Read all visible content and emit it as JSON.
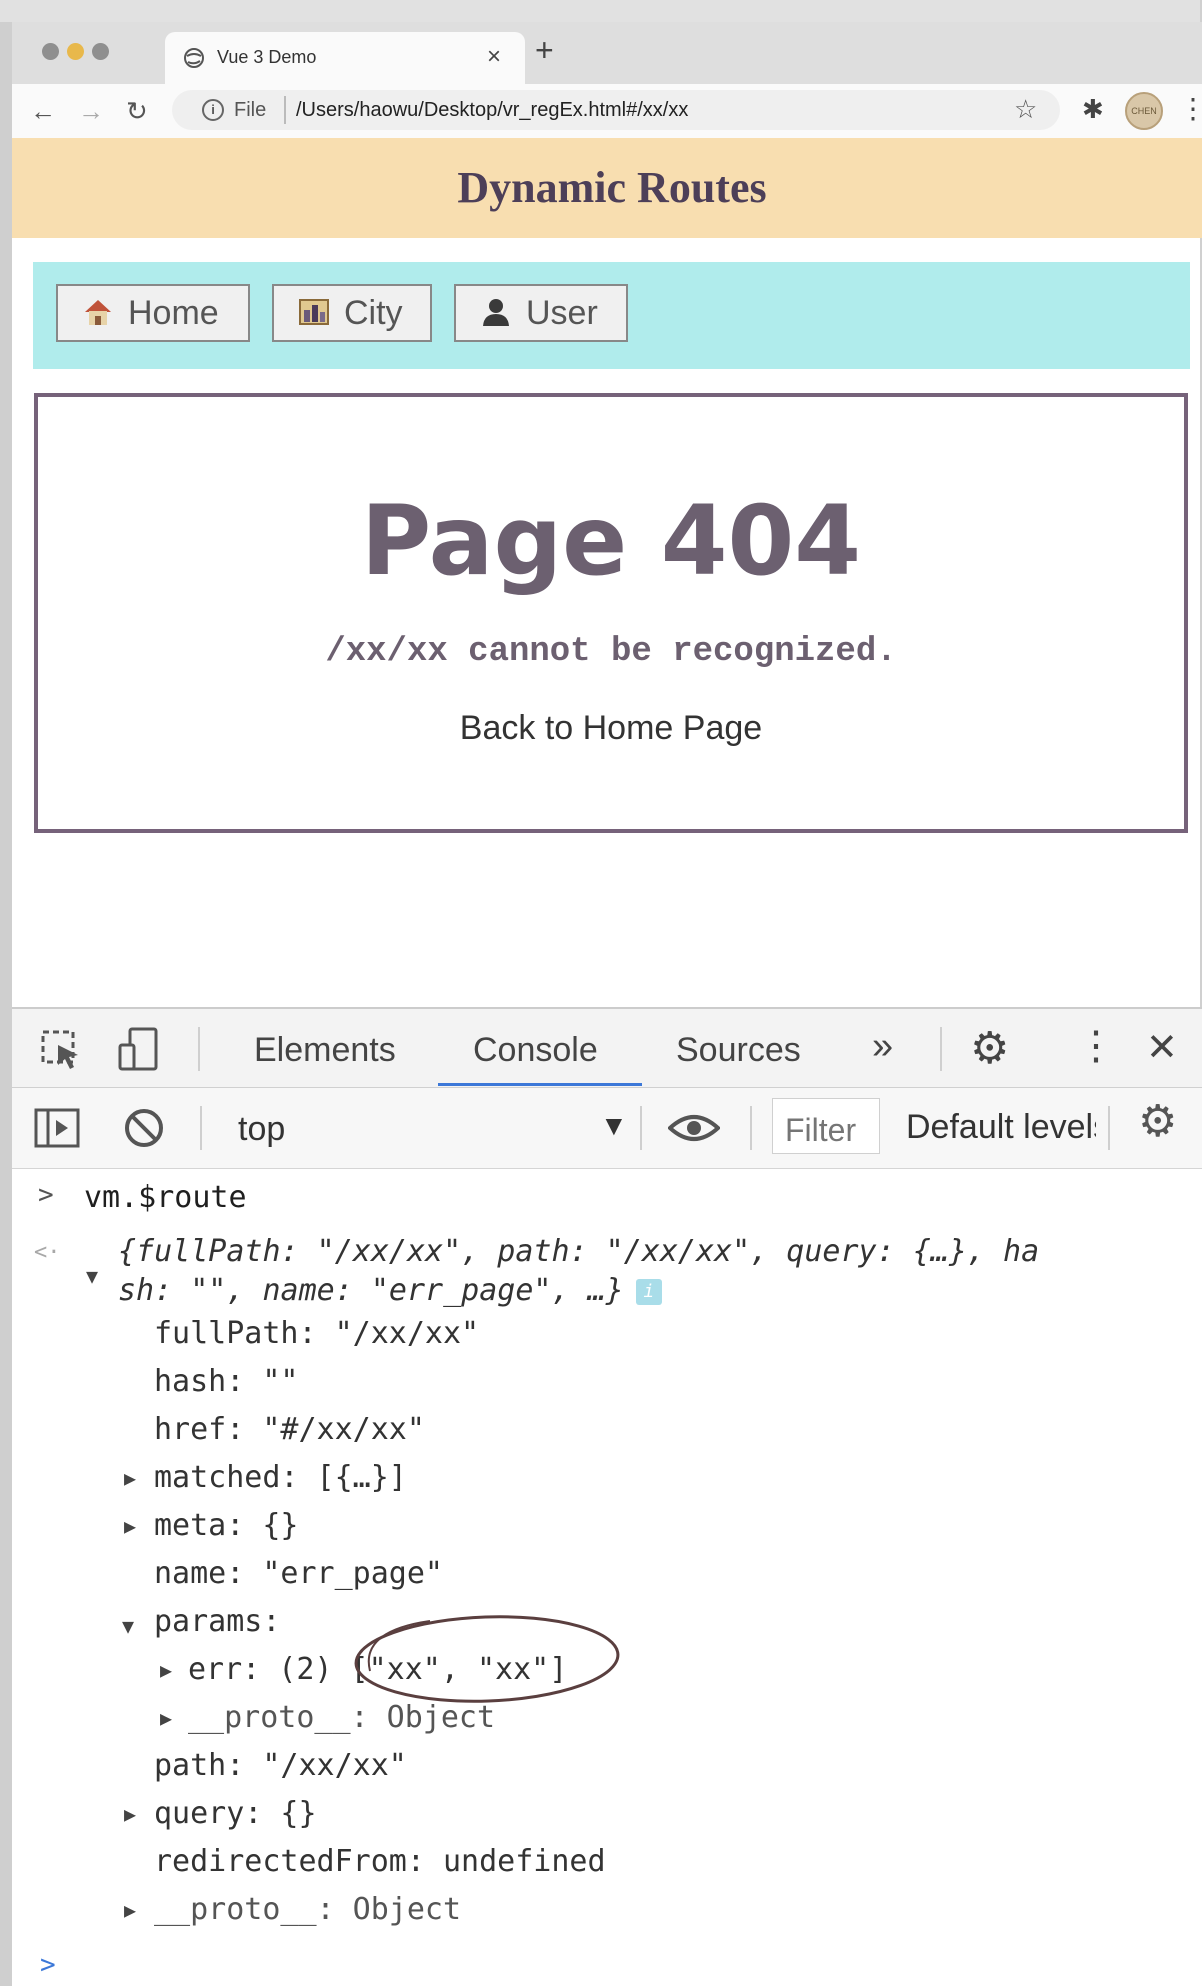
{
  "browser": {
    "tab_title": "Vue 3 Demo",
    "new_tab_symbol": "+",
    "close_symbol": "×",
    "url_scheme": "File",
    "url": "/Users/haowu/Desktop/vr_regEx.html#/xx/xx",
    "profile_text": "CHEN WUXI"
  },
  "app": {
    "title": "Dynamic Routes",
    "nav": [
      {
        "label": "Home",
        "icon": "house-icon"
      },
      {
        "label": "City",
        "icon": "city-picture-icon"
      },
      {
        "label": "User",
        "icon": "user-silhouette-icon"
      }
    ],
    "page_heading": "Page 404",
    "message": "/xx/xx cannot be recognized.",
    "back_link": "Back to Home Page"
  },
  "devtools": {
    "tabs": [
      "Elements",
      "Console",
      "Sources"
    ],
    "active_tab": "Console",
    "more_tabs_symbol": "»",
    "context": "top",
    "filter_placeholder": "Filter",
    "levels_label": "Default levels",
    "accent_color": "#3c78d8"
  },
  "console": {
    "prompt_symbol": ">",
    "return_symbol": "<·",
    "command": "vm.$route",
    "summary_line1": "{fullPath: \"/xx/xx\", path: \"/xx/xx\", query: {…}, ha",
    "summary_line2": "sh: \"\", name: \"err_page\", …}",
    "info_badge": "i",
    "props": [
      {
        "text": "fullPath: \"/xx/xx\""
      },
      {
        "text": "hash: \"\""
      },
      {
        "text": "href: \"#/xx/xx\""
      },
      {
        "text": "matched: [{…}]"
      },
      {
        "text": "meta: {}"
      },
      {
        "text": "name: \"err_page\""
      },
      {
        "text": "params:"
      },
      {
        "text": "err: (2) [\"xx\", \"xx\"]"
      },
      {
        "text": "__proto__: Object"
      },
      {
        "text": "path: \"/xx/xx\""
      },
      {
        "text": "query: {}"
      },
      {
        "text": "redirectedFrom: undefined"
      },
      {
        "text": "__proto__: Object"
      }
    ],
    "annotation_color": "#5a3f3f"
  }
}
